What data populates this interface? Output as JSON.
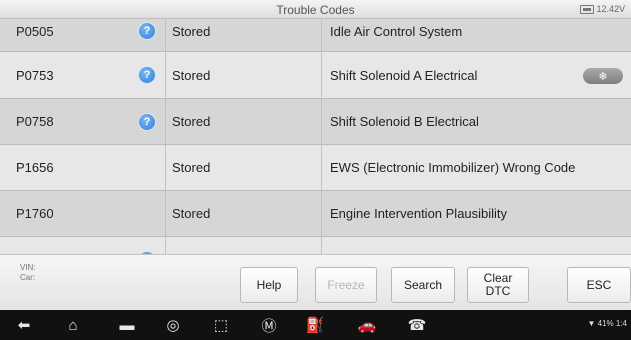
{
  "titlebar": {
    "title": "Trouble Codes",
    "battery_voltage": "12.42V"
  },
  "table": {
    "rows": [
      {
        "code": "P0505",
        "has_info": true,
        "status": "Stored",
        "description": "Idle Air Control System",
        "has_freeze": false
      },
      {
        "code": "P0753",
        "has_info": true,
        "status": "Stored",
        "description": "Shift Solenoid A Electrical",
        "has_freeze": true
      },
      {
        "code": "P0758",
        "has_info": true,
        "status": "Stored",
        "description": "Shift Solenoid B Electrical",
        "has_freeze": false
      },
      {
        "code": "P1656",
        "has_info": false,
        "status": "Stored",
        "description": "EWS (Electronic Immobilizer) Wrong Code",
        "has_freeze": false
      },
      {
        "code": "P1760",
        "has_info": false,
        "status": "Stored",
        "description": "Engine Intervention Plausibility",
        "has_freeze": false
      },
      {
        "code": "",
        "has_info": true,
        "status": "",
        "description": "",
        "has_freeze": false
      }
    ],
    "freeze_icon": "snowflake-icon"
  },
  "vehicle": {
    "vin_label": "VIN:",
    "car_label": "Car:"
  },
  "buttons": {
    "help": "Help",
    "freeze": "Freeze",
    "search": "Search",
    "clear_line1": "Clear",
    "clear_line2": "DTC",
    "esc": "ESC"
  },
  "statusbar": {
    "right_text": "41%",
    "time": "1:4"
  },
  "nav_icons": [
    "back-icon",
    "home-icon",
    "recent-apps-icon",
    "browser-icon",
    "connect-icon",
    "maxisys-home-icon",
    "vehicle-icon",
    "car-icon",
    "remote-icon"
  ],
  "colors": {
    "info_blue": "#2f7fd6",
    "row_light": "#e7e7e7",
    "row_dark": "#d6d6d6"
  }
}
